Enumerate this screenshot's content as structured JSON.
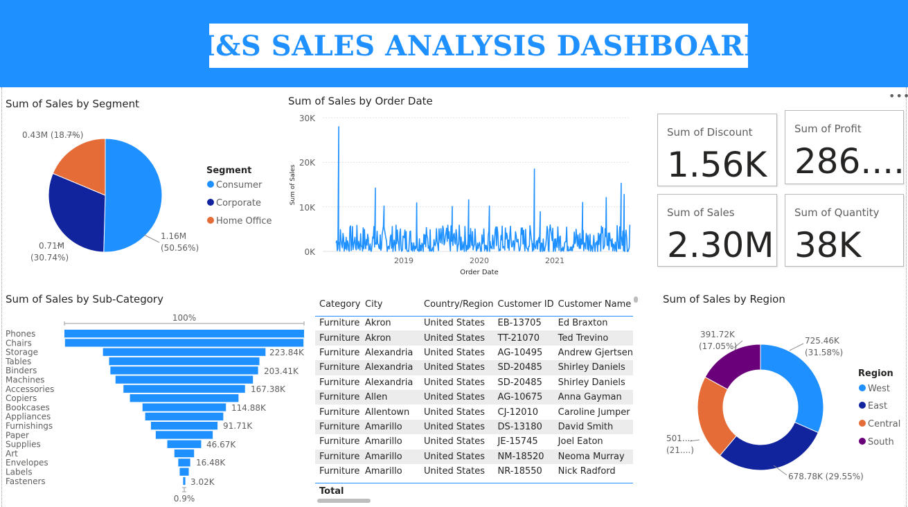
{
  "header": {
    "title": "H&S SALES ANALYSIS DASHBOARD"
  },
  "colors": {
    "banner": "#1e90ff",
    "consumer": "#1e90ff",
    "corporate": "#12239e",
    "home_office": "#e66c37",
    "west": "#1e90ff",
    "east": "#12239e",
    "central": "#e66c37",
    "south": "#6b007b"
  },
  "icons": {
    "more_options": "more-options-icon"
  },
  "segment_chart": {
    "title": "Sum of Sales by Segment",
    "legend_title": "Segment",
    "legend": [
      "Consumer",
      "Corporate",
      "Home Office"
    ],
    "labels": {
      "consumer_value": "1.16M",
      "consumer_pct": "(50.56%)",
      "corporate_value": "0.71M",
      "corporate_pct": "(30.74%)",
      "home_office": "0.43M (18.7%)"
    }
  },
  "order_date_chart": {
    "title": "Sum of Sales by Order Date",
    "xlabel": "Order Date",
    "ylabel": "Sum of Sales",
    "y_ticks": [
      "30K",
      "20K",
      "10K",
      "0K"
    ],
    "x_ticks": [
      "2019",
      "2020",
      "2021"
    ]
  },
  "kpis": {
    "discount": {
      "label": "Sum of Discount",
      "value": "1.56K"
    },
    "profit": {
      "label": "Sum of Profit",
      "value": "286...."
    },
    "sales": {
      "label": "Sum of Sales",
      "value": "2.30M"
    },
    "quantity": {
      "label": "Sum of Quantity",
      "value": "38K"
    }
  },
  "subcategory_chart": {
    "title": "Sum of Sales by Sub-Category",
    "top_label": "100%",
    "bottom_label": "0.9%",
    "value_labels": [
      "223.84K",
      "203.41K",
      "167.38K",
      "114.88K",
      "91.71K",
      "46.67K",
      "16.48K",
      "3.02K"
    ]
  },
  "table": {
    "columns": [
      "Category",
      "City",
      "Country/Region",
      "Customer ID",
      "Customer Name"
    ],
    "rows": [
      [
        "Furniture",
        "Akron",
        "United States",
        "EB-13705",
        "Ed Braxton"
      ],
      [
        "Furniture",
        "Akron",
        "United States",
        "TT-21070",
        "Ted Trevino"
      ],
      [
        "Furniture",
        "Alexandria",
        "United States",
        "AG-10495",
        "Andrew Gjertsen"
      ],
      [
        "Furniture",
        "Alexandria",
        "United States",
        "SD-20485",
        "Shirley Daniels"
      ],
      [
        "Furniture",
        "Alexandria",
        "United States",
        "SD-20485",
        "Shirley Daniels"
      ],
      [
        "Furniture",
        "Allen",
        "United States",
        "AG-10675",
        "Anna Gayman"
      ],
      [
        "Furniture",
        "Allentown",
        "United States",
        "CJ-12010",
        "Caroline Jumper"
      ],
      [
        "Furniture",
        "Amarillo",
        "United States",
        "DS-13180",
        "David Smith"
      ],
      [
        "Furniture",
        "Amarillo",
        "United States",
        "JE-15745",
        "Joel Eaton"
      ],
      [
        "Furniture",
        "Amarillo",
        "United States",
        "NM-18520",
        "Neoma Murray"
      ],
      [
        "Furniture",
        "Amarillo",
        "United States",
        "NR-18550",
        "Nick Radford"
      ]
    ],
    "total_label": "Total"
  },
  "region_chart": {
    "title": "Sum of Sales by Region",
    "legend_title": "Region",
    "legend": [
      "West",
      "East",
      "Central",
      "South"
    ],
    "labels": {
      "west_value": "725.46K",
      "west_pct": "(31.58%)",
      "east": "678.78K (29.55%)",
      "central_value": "501....",
      "central_pct": "(21....)",
      "south_value": "391.72K",
      "south_pct": "(17.05%)"
    }
  },
  "chart_data": [
    {
      "type": "pie",
      "title": "Sum of Sales by Segment",
      "categories": [
        "Consumer",
        "Corporate",
        "Home Office"
      ],
      "values": [
        1.16,
        0.71,
        0.43
      ],
      "percentages": [
        50.56,
        30.74,
        18.7
      ],
      "unit": "M",
      "legend_position": "right"
    },
    {
      "type": "line",
      "title": "Sum of Sales by Order Date",
      "xlabel": "Order Date",
      "ylabel": "Sum of Sales",
      "xlim": [
        "2018-01-01",
        "2021-12-31"
      ],
      "ylim": [
        0,
        30000
      ],
      "grid": true,
      "peaks": [
        {
          "x": "2018-03-18",
          "y": 28000
        },
        {
          "x": "2018-09-08",
          "y": 14200
        },
        {
          "x": "2018-10-19",
          "y": 10200
        },
        {
          "x": "2019-03-23",
          "y": 10900
        },
        {
          "x": "2019-09-08",
          "y": 10100
        },
        {
          "x": "2019-11-25",
          "y": 11600
        },
        {
          "x": "2020-03-02",
          "y": 10200
        },
        {
          "x": "2020-10-02",
          "y": 18500
        },
        {
          "x": "2020-10-30",
          "y": 8900
        },
        {
          "x": "2021-05-19",
          "y": 11000
        },
        {
          "x": "2021-09-08",
          "y": 12100
        },
        {
          "x": "2021-11-18",
          "y": 15300
        },
        {
          "x": "2021-12-02",
          "y": 12800
        }
      ],
      "baseline_range": [
        0,
        6000
      ]
    },
    {
      "type": "bar",
      "subtype": "funnel",
      "title": "Sum of Sales by Sub-Category",
      "categories": [
        "Phones",
        "Chairs",
        "Storage",
        "Tables",
        "Binders",
        "Machines",
        "Accessories",
        "Copiers",
        "Bookcases",
        "Appliances",
        "Furnishings",
        "Paper",
        "Supplies",
        "Art",
        "Envelopes",
        "Labels",
        "Fasteners"
      ],
      "values": [
        330010,
        328450,
        223840,
        206970,
        203410,
        189240,
        167380,
        149530,
        114880,
        107530,
        91710,
        78480,
        46670,
        27120,
        16480,
        12490,
        3020
      ]
    },
    {
      "type": "pie",
      "subtype": "donut",
      "title": "Sum of Sales by Region",
      "categories": [
        "West",
        "East",
        "Central",
        "South"
      ],
      "values": [
        725.46,
        678.78,
        501.24,
        391.72
      ],
      "percentages": [
        31.58,
        29.55,
        21.82,
        17.05
      ],
      "unit": "K",
      "legend_position": "right"
    }
  ]
}
